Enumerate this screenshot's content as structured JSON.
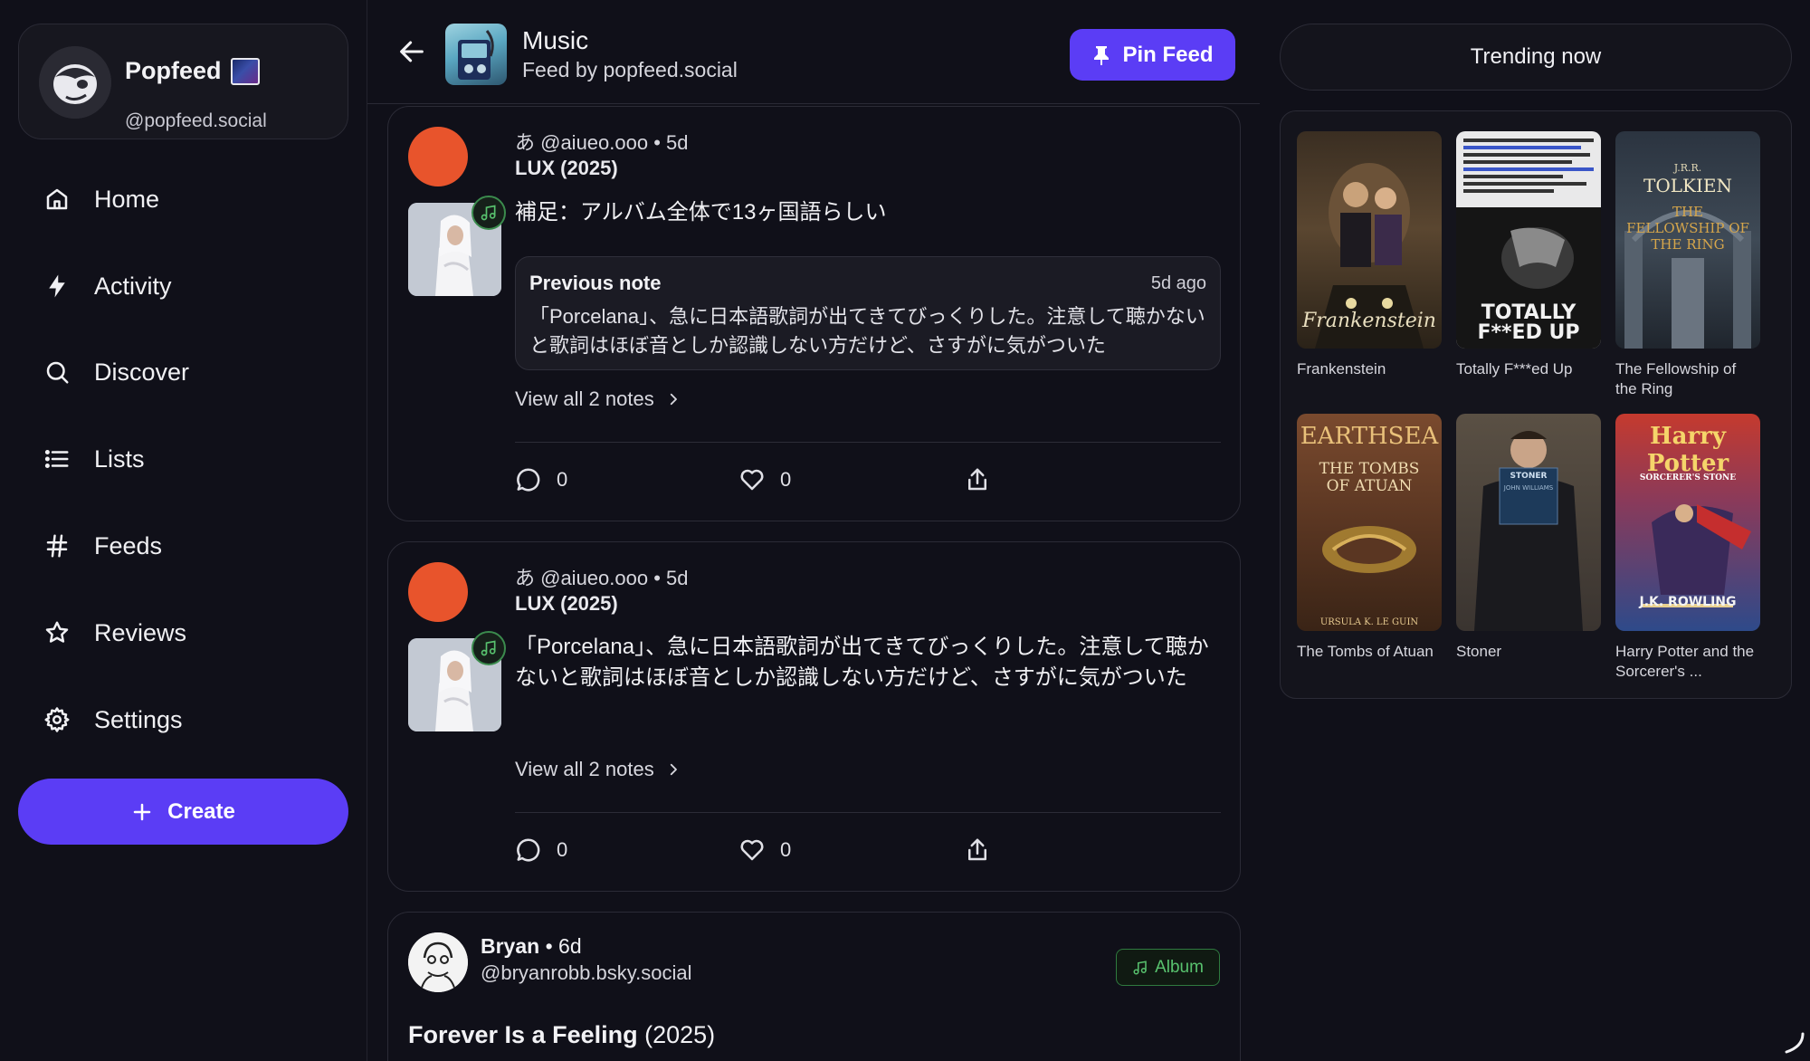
{
  "sidebar": {
    "profile": {
      "name": "Popfeed",
      "handle": "@popfeed.social"
    },
    "nav": [
      {
        "label": "Home",
        "icon": "home-icon"
      },
      {
        "label": "Activity",
        "icon": "bolt-icon"
      },
      {
        "label": "Discover",
        "icon": "search-icon"
      },
      {
        "label": "Lists",
        "icon": "list-icon"
      },
      {
        "label": "Feeds",
        "icon": "hash-icon"
      },
      {
        "label": "Reviews",
        "icon": "star-icon"
      },
      {
        "label": "Settings",
        "icon": "gear-icon"
      }
    ],
    "create_label": "Create"
  },
  "feed_header": {
    "title": "Music",
    "subtitle": "Feed by popfeed.social",
    "pin_label": "Pin Feed"
  },
  "posts": [
    {
      "meta": "あ @aiueo.ooo • 5d",
      "work": "LUX (2025)",
      "text": "補足：アルバム全体で13ヶ国語らしい",
      "previous_note": {
        "label": "Previous note",
        "time": "5d ago",
        "text": "「Porcelana」、急に日本語歌詞が出てきてびっくりした。注意して聴かないと歌詞はほぼ音としか認識しない方だけど、さすがに気がついた"
      },
      "view_all": "View all 2 notes",
      "replies": "0",
      "likes": "0"
    },
    {
      "meta": "あ @aiueo.ooo • 5d",
      "work": "LUX (2025)",
      "text": "「Porcelana」、急に日本語歌詞が出てきてびっくりした。注意して聴かないと歌詞はほぼ音としか認識しない方だけど、さすがに気がついた",
      "view_all": "View all 2 notes",
      "replies": "0",
      "likes": "0"
    },
    {
      "author": "Bryan",
      "age": "• 6d",
      "handle": "@bryanrobb.bsky.social",
      "badge": "Album",
      "work_title": "Forever Is a Feeling",
      "work_year": "(2025)"
    }
  ],
  "trending": {
    "header": "Trending now",
    "books": [
      {
        "title": "Frankenstein"
      },
      {
        "title": "Totally F***ed Up"
      },
      {
        "title": "The Fellowship of the Ring"
      },
      {
        "title": "The Tombs of Atuan"
      },
      {
        "title": "Stoner"
      },
      {
        "title": "Harry Potter and the Sorcerer's ..."
      }
    ],
    "cover_text": {
      "frankenstein": "Frankenstein",
      "totally": "TOTALLY F**ED UP",
      "tolkien_top": "J.R.R.",
      "tolkien": "TOLKIEN",
      "fellowship": "THE FELLOWSHIP OF THE RING",
      "earthsea": "EARTHSEA",
      "tombs": "THE TOMBS OF ATUAN",
      "leguin": "URSULA K. LE GUIN",
      "stoner": "STONER",
      "stoner_author": "JOHN WILLIAMS",
      "harry": "Harry Potter",
      "stone": "SORCERER'S STONE",
      "rowling": "J.K. ROWLING"
    }
  },
  "colors": {
    "background": "#101019",
    "accent": "#5b3df5",
    "album_green": "#58c26e",
    "avatar_orange": "#e8542c"
  }
}
